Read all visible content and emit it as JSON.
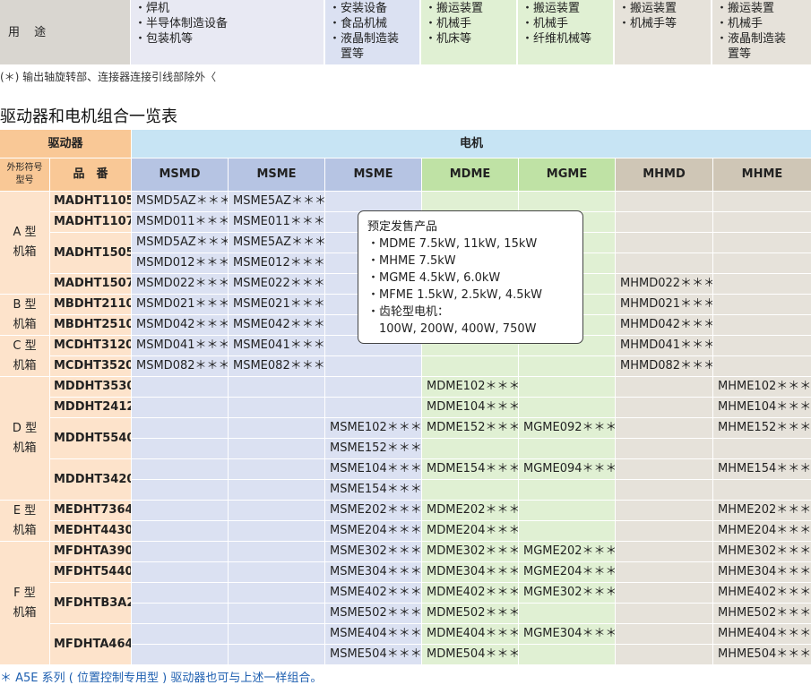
{
  "usage": {
    "label": "用 途",
    "columns": [
      {
        "items": [
          "・焊机",
          "・半导体制造设备",
          "・包装机等"
        ]
      },
      {
        "items": [
          "・安装设备",
          "・食品机械",
          "・液晶制造装",
          "　置等"
        ]
      },
      {
        "items": [
          "・搬运装置",
          "・机械手",
          "・机床等"
        ]
      },
      {
        "items": [
          "・搬运装置",
          "・机械手",
          "・纤维机械等"
        ]
      },
      {
        "items": [
          "・搬运装置",
          "・机械手等"
        ]
      },
      {
        "items": [
          "・搬运装置",
          "・机械手",
          "・液晶制造装",
          "　置等"
        ]
      }
    ]
  },
  "footnote_top": "(＊) 输出轴旋转部、连接器连接引线部除外〈",
  "section_title": "驱动器和电机组合一览表",
  "table": {
    "driver_header": "驱动器",
    "motor_header": "电机",
    "col_type": "外形符号\n型号",
    "col_part": "品　番",
    "motor_cols": [
      "MSMD",
      "MSME",
      "MSME",
      "MDME",
      "MGME",
      "MHMD",
      "MHME"
    ],
    "groups": [
      {
        "label": "A 型\n机箱"
      },
      {
        "label": "B 型\n机箱"
      },
      {
        "label": "C 型\n机箱"
      },
      {
        "label": "D 型\n机箱"
      },
      {
        "label": "E 型\n机箱"
      },
      {
        "label": "F 型\n机箱"
      }
    ],
    "part_numbers": [
      "MADHT1105",
      "MADHT1107",
      "MADHT1505",
      "MADHT1507",
      "MBDHT2110",
      "MBDHT2510",
      "MCDHT3120",
      "MCDHT3520",
      "MDDHT3530",
      "MDDHT2412",
      "MDDHT5540",
      "MDDHT3420",
      "MEDHT7364",
      "MEDHT4430",
      "MFDHTA390",
      "MFDHT5440",
      "MFDHTB3A2",
      "MFDHTA464"
    ],
    "cells": [
      [
        "MSMD5AZ＊＊＊",
        "MSME5AZ＊＊＊",
        "",
        "",
        "",
        "",
        ""
      ],
      [
        "MSMD011＊＊＊",
        "MSME011＊＊＊",
        "",
        "",
        "",
        "",
        ""
      ],
      [
        "MSMD5AZ＊＊＊",
        "MSME5AZ＊＊＊",
        "",
        "",
        "",
        "",
        ""
      ],
      [
        "MSMD012＊＊＊",
        "MSME012＊＊＊",
        "",
        "",
        "",
        "",
        ""
      ],
      [
        "MSMD022＊＊＊",
        "MSME022＊＊＊",
        "",
        "",
        "",
        "MHMD022＊＊＊",
        ""
      ],
      [
        "MSMD021＊＊＊",
        "MSME021＊＊＊",
        "",
        "",
        "",
        "MHMD021＊＊＊",
        ""
      ],
      [
        "MSMD042＊＊＊",
        "MSME042＊＊＊",
        "",
        "",
        "",
        "MHMD042＊＊＊",
        ""
      ],
      [
        "MSMD041＊＊＊",
        "MSME041＊＊＊",
        "",
        "",
        "",
        "MHMD041＊＊＊",
        ""
      ],
      [
        "MSMD082＊＊＊",
        "MSME082＊＊＊",
        "",
        "",
        "",
        "MHMD082＊＊＊",
        ""
      ],
      [
        "",
        "",
        "",
        "MDME102＊＊＊",
        "",
        "",
        "MHME102＊＊＊"
      ],
      [
        "",
        "",
        "",
        "MDME104＊＊＊",
        "",
        "",
        "MHME104＊＊＊"
      ],
      [
        "",
        "",
        "MSME102＊＊＊",
        "MDME152＊＊＊",
        "MGME092＊＊＊",
        "",
        "MHME152＊＊＊"
      ],
      [
        "",
        "",
        "MSME152＊＊＊",
        "",
        "",
        "",
        ""
      ],
      [
        "",
        "",
        "MSME104＊＊＊",
        "MDME154＊＊＊",
        "MGME094＊＊＊",
        "",
        "MHME154＊＊＊"
      ],
      [
        "",
        "",
        "MSME154＊＊＊",
        "",
        "",
        "",
        ""
      ],
      [
        "",
        "",
        "MSME202＊＊＊",
        "MDME202＊＊＊",
        "",
        "",
        "MHME202＊＊＊"
      ],
      [
        "",
        "",
        "MSME204＊＊＊",
        "MDME204＊＊＊",
        "",
        "",
        "MHME204＊＊＊"
      ],
      [
        "",
        "",
        "MSME302＊＊＊",
        "MDME302＊＊＊",
        "MGME202＊＊＊",
        "",
        "MHME302＊＊＊"
      ],
      [
        "",
        "",
        "MSME304＊＊＊",
        "MDME304＊＊＊",
        "MGME204＊＊＊",
        "",
        "MHME304＊＊＊"
      ],
      [
        "",
        "",
        "MSME402＊＊＊",
        "MDME402＊＊＊",
        "MGME302＊＊＊",
        "",
        "MHME402＊＊＊"
      ],
      [
        "",
        "",
        "MSME502＊＊＊",
        "MDME502＊＊＊",
        "",
        "",
        "MHME502＊＊＊"
      ],
      [
        "",
        "",
        "MSME404＊＊＊",
        "MDME404＊＊＊",
        "MGME304＊＊＊",
        "",
        "MHME404＊＊＊"
      ],
      [
        "",
        "",
        "MSME504＊＊＊",
        "MDME504＊＊＊",
        "",
        "",
        "MHME504＊＊＊"
      ]
    ]
  },
  "popup": {
    "title": "预定发售产品",
    "lines": [
      "・MDME 7.5kW, 11kW, 15kW",
      "・MHME 7.5kW",
      "・MGME 4.5kW, 6.0kW",
      "・MFME 1.5kW, 2.5kW, 4.5kW",
      "・齿轮型电机：",
      "　100W, 200W, 400W, 750W"
    ]
  },
  "footnote_bottom": "＊ A5E 系列 ( 位置控制专用型 ) 驱动器也可与上述一样组合。",
  "colors": {
    "orange": "#f9c896",
    "blue_header": "#b6c4e3",
    "green_header": "#bfe2a5",
    "tan_header": "#cfc6b6",
    "motor_bar": "#c7e4f4",
    "note_blue": "#1e5fb0"
  }
}
